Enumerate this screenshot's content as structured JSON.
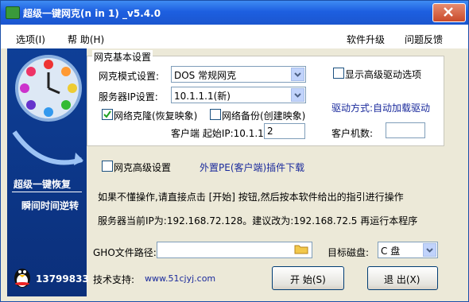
{
  "window": {
    "title": "超级一键网克(n in 1) _v5.4.0"
  },
  "menu": {
    "options": "选项(I)",
    "help": "帮 助(H)",
    "upgrade": "软件升级",
    "feedback": "问题反馈"
  },
  "sidebar": {
    "tagline1": "超级一键恢复",
    "tagline2": "瞬间时间逆转",
    "qq_number": "13799833"
  },
  "basic": {
    "group_title": "网克基本设置",
    "mode_label": "网克模式设置:",
    "mode_value": "DOS 常规网克",
    "server_ip_label": "服务器IP设置:",
    "server_ip_value": "10.1.1.1(新)",
    "clone_label": "网络克隆(恢复映象)",
    "clone_checked": true,
    "backup_label": "网络备份(创建映象)",
    "backup_checked": false,
    "client_ip_label": "客户端 起始IP:10.1.1.",
    "client_ip_value": "2",
    "show_advanced_label": "显示高级驱动选项",
    "show_advanced_checked": false,
    "driver_label": "驱动方式:自动加载驱动",
    "client_count_label": "客户机数:",
    "client_count_value": ""
  },
  "advanced": {
    "label": "网克高级设置",
    "checked": false,
    "pe_link": "外置PE(客户端)插件下载"
  },
  "info": {
    "line1": "如果不懂操作,请直接点击 [开始] 按钮,然后按本软件给出的指引进行操作",
    "line2": "服务器当前IP为:192.168.72.128。建议改为:192.168.72.5 再运行本程序"
  },
  "gho": {
    "label": "GHO文件路径:",
    "value": ""
  },
  "target": {
    "label": "目标磁盘:",
    "value": "C 盘"
  },
  "support": {
    "label": "技术支持:",
    "url": "www.51cjyj.com"
  },
  "buttons": {
    "start": "开 始(S)",
    "exit": "退 出(X)"
  }
}
